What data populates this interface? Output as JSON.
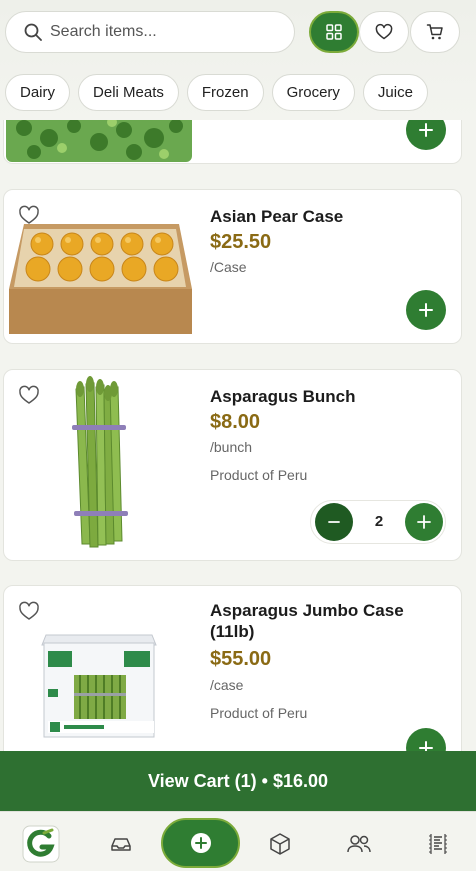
{
  "search": {
    "placeholder": "Search items..."
  },
  "header": {
    "buttons": [
      {
        "name": "grid-view",
        "icon": "grid-icon",
        "active": true
      },
      {
        "name": "favorites",
        "icon": "heart-icon",
        "active": false
      },
      {
        "name": "cart",
        "icon": "cart-icon",
        "active": false
      }
    ]
  },
  "categories": [
    "Dairy",
    "Deli Meats",
    "Frozen",
    "Grocery",
    "Juice"
  ],
  "products": [
    {
      "name": "Asian Pear Case",
      "price": "$25.50",
      "unit": "/Case",
      "origin": ""
    },
    {
      "name": "Asparagus Bunch",
      "price": "$8.00",
      "unit": "/bunch",
      "origin": "Product of Peru",
      "quantity": "2"
    },
    {
      "name": "Asparagus Jumbo Case (11lb)",
      "price": "$55.00",
      "unit": "/case",
      "origin": "Product of Peru"
    }
  ],
  "cart": {
    "label": "View Cart (1) • $16.00"
  },
  "nav": [
    "logo",
    "inbox-icon",
    "add-icon",
    "box-icon",
    "users-icon",
    "receipt-icon"
  ],
  "colors": {
    "primary": "#2f7d32",
    "price": "#8a6a14",
    "accent": "#7cab3a"
  }
}
